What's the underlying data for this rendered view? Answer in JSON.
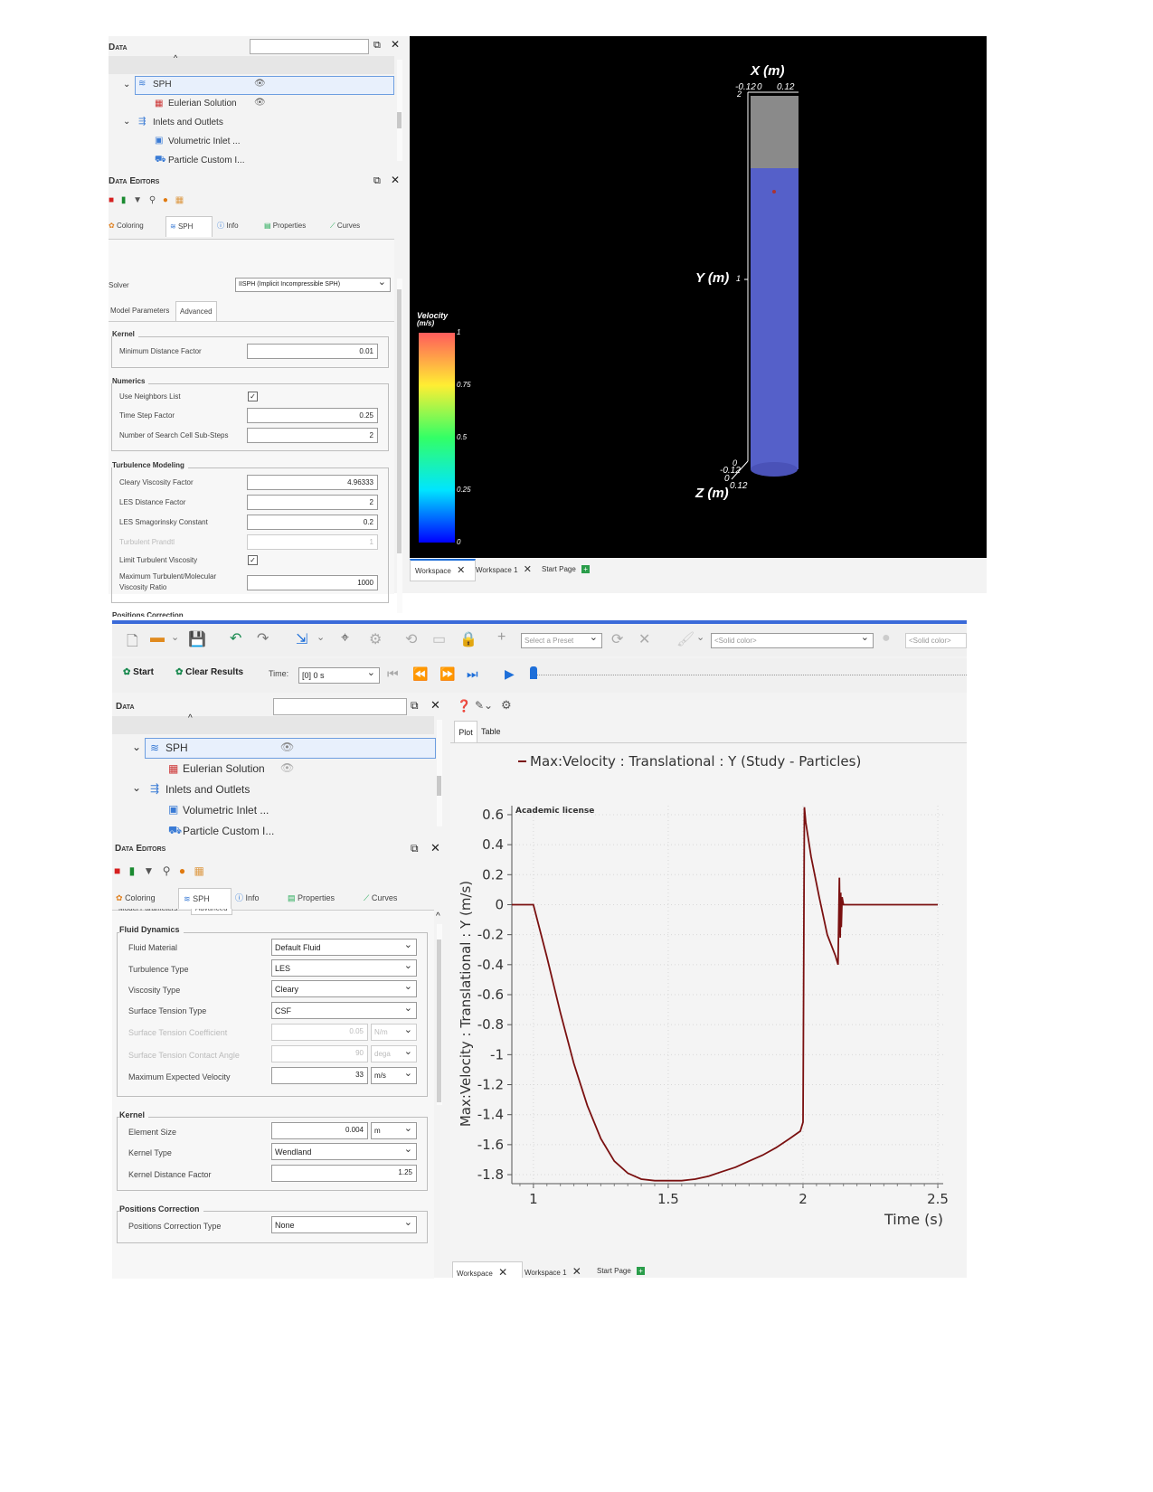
{
  "top": {
    "data_panel": {
      "title": "Data",
      "tree": [
        {
          "label": "SPH"
        },
        {
          "label": "Eulerian Solution"
        },
        {
          "label": "Inlets and Outlets"
        },
        {
          "label": "Volumetric Inlet ..."
        },
        {
          "label": "Particle Custom I..."
        }
      ]
    },
    "editors": {
      "title": "Data Editors",
      "tabs": [
        "Coloring",
        "SPH",
        "Info",
        "Properties",
        "Curves"
      ],
      "solver_label": "Solver",
      "solver_value": "IISPH (Implicit Incompressible SPH)",
      "subtabs": [
        "Model Parameters",
        "Advanced"
      ],
      "kernel": {
        "title": "Kernel",
        "min_distance_label": "Minimum Distance Factor",
        "min_distance_value": "0.01"
      },
      "numerics": {
        "title": "Numerics",
        "use_neighbors_label": "Use Neighbors List",
        "time_step_label": "Time Step Factor",
        "time_step_value": "0.25",
        "substeps_label": "Number of Search Cell Sub-Steps",
        "substeps_value": "2"
      },
      "turbulence": {
        "title": "Turbulence Modeling",
        "cleary_label": "Cleary Viscosity Factor",
        "cleary_value": "4.96333",
        "les_dist_label": "LES Distance Factor",
        "les_dist_value": "2",
        "smag_label": "LES Smagorinsky Constant",
        "smag_value": "0.2",
        "prandtl_label": "Turbulent Prandtl",
        "prandtl_value": "1",
        "limit_label": "Limit Turbulent Viscosity",
        "max_ratio_label1": "Maximum Turbulent/Molecular",
        "max_ratio_label2": "Viscosity Ratio",
        "max_ratio_value": "1000"
      },
      "positions_partial": "Positions Correction"
    },
    "viewport": {
      "x_axis_title": "X (m)",
      "x_ticks": [
        "-0.12",
        "0",
        "0.12"
      ],
      "x_left_edge_tick": "2",
      "y_axis_title": "Y (m)",
      "y_mid_tick": "1",
      "z_axis_title": "Z (m)",
      "z_ticks": [
        "-0.12",
        "0",
        "0.12"
      ],
      "z_zero": "0",
      "legend_title1": "Velocity",
      "legend_title2": "(m/s)",
      "legend_ticks": [
        "1",
        "0.75",
        "0.5",
        "0.25",
        "0"
      ]
    },
    "bottom_tabs": [
      "Workspace",
      "Workspace 1",
      "Start Page"
    ]
  },
  "bottom": {
    "toolbar": {
      "preset_placeholder": "Select a Preset",
      "color1": "<Solid color>",
      "color2": "<Solid color>",
      "start_label": "Start",
      "clear_label": "Clear Results",
      "time_label": "Time:",
      "time_value": "[0] 0 s"
    },
    "data_panel": {
      "title": "Data",
      "tree": [
        {
          "label": "SPH"
        },
        {
          "label": "Eulerian Solution"
        },
        {
          "label": "Inlets and Outlets"
        },
        {
          "label": "Volumetric Inlet ..."
        },
        {
          "label": "Particle Custom I..."
        }
      ]
    },
    "editors": {
      "title": "Data Editors",
      "tabs": [
        "Coloring",
        "SPH",
        "Info",
        "Properties",
        "Curves"
      ],
      "subtabs_partial": [
        "Model Parameters",
        "Advanced"
      ],
      "fluid": {
        "title": "Fluid Dynamics",
        "rows": [
          {
            "label": "Fluid Material",
            "value": "Default Fluid"
          },
          {
            "label": "Turbulence Type",
            "value": "LES"
          },
          {
            "label": "Viscosity Type",
            "value": "Cleary"
          },
          {
            "label": "Surface Tension Type",
            "value": "CSF"
          }
        ],
        "st_coeff_label": "Surface Tension Coefficient",
        "st_coeff_value": "0.05",
        "st_coeff_unit": "N/m",
        "st_angle_label": "Surface Tension Contact Angle",
        "st_angle_value": "90",
        "st_angle_unit": "dega",
        "max_vel_label": "Maximum Expected Velocity",
        "max_vel_value": "33",
        "max_vel_unit": "m/s"
      },
      "kernel": {
        "title": "Kernel",
        "element_size_label": "Element Size",
        "element_size_value": "0.004",
        "element_size_unit": "m",
        "kernel_type_label": "Kernel Type",
        "kernel_type_value": "Wendland",
        "kernel_dist_label": "Kernel Distance Factor",
        "kernel_dist_value": "1.25"
      },
      "positions": {
        "title": "Positions Correction",
        "type_label": "Positions Correction Type",
        "type_value": "None"
      }
    },
    "plot_tabs": [
      "Plot",
      "Table"
    ],
    "bottom_tabs": [
      "Workspace",
      "Workspace 1",
      "Start Page"
    ]
  },
  "colors": {
    "curve": "#7a1010",
    "accent": "#1e6fd9",
    "viewport_bg": "#000000",
    "cylinder_fluid": "#5560c9",
    "cylinder_top": "#8a8a8a"
  },
  "chart_data": {
    "type": "line",
    "title": "Max:Velocity : Translational : Y (Study - Particles)",
    "subtitle": "Academic license",
    "xlabel": "Time (s)",
    "ylabel": "Max:Velocity : Translational : Y (m/s)",
    "xlim": [
      0.92,
      2.52
    ],
    "ylim": [
      -1.86,
      0.66
    ],
    "x_ticks": [
      "1",
      "1.5",
      "2",
      "2.5"
    ],
    "y_ticks": [
      "0.6",
      "0.4",
      "0.2",
      "0",
      "-0.2",
      "-0.4",
      "-0.6",
      "-0.8",
      "-1",
      "-1.2",
      "-1.4",
      "-1.6",
      "-1.8"
    ],
    "grid": true,
    "series": [
      {
        "name": "Max:Velocity : Translational : Y (Study - Particles)",
        "x": [
          0.92,
          1.0,
          1.05,
          1.1,
          1.15,
          1.2,
          1.25,
          1.3,
          1.35,
          1.4,
          1.45,
          1.5,
          1.55,
          1.6,
          1.65,
          1.7,
          1.75,
          1.8,
          1.85,
          1.9,
          1.95,
          1.99,
          2.0,
          2.005,
          2.01,
          2.03,
          2.06,
          2.09,
          2.12,
          2.13,
          2.135,
          2.138,
          2.14,
          2.142,
          2.145,
          2.15,
          2.2,
          2.3,
          2.4,
          2.5
        ],
        "y": [
          0.0,
          0.0,
          -0.35,
          -0.72,
          -1.06,
          -1.34,
          -1.56,
          -1.71,
          -1.79,
          -1.83,
          -1.84,
          -1.84,
          -1.84,
          -1.83,
          -1.81,
          -1.78,
          -1.75,
          -1.71,
          -1.67,
          -1.62,
          -1.56,
          -1.51,
          -1.45,
          0.65,
          0.55,
          0.32,
          0.05,
          -0.2,
          -0.34,
          -0.4,
          0.18,
          -0.22,
          0.08,
          -0.15,
          0.05,
          0.0,
          0.0,
          0.0,
          0.0,
          0.0
        ]
      }
    ]
  }
}
